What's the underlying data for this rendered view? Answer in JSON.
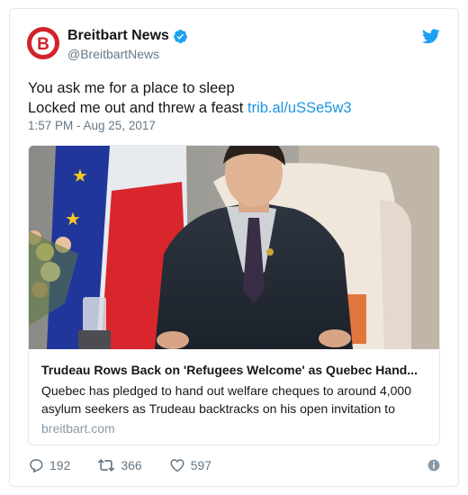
{
  "account": {
    "display_name": "Breitbart News",
    "handle": "@BreitbartNews",
    "avatar_letter": "B",
    "brand_color": "#d3232a",
    "verified": true
  },
  "tweet": {
    "line1": "You ask me for a place to sleep",
    "line2_text": "Locked me out and threw a feast ",
    "link_text": "trib.al/uSSe5w3",
    "timestamp": "1:57 PM - Aug 25, 2017"
  },
  "card": {
    "title": "Trudeau Rows Back on 'Refugees Welcome' as Quebec Hand...",
    "description": "Quebec has pledged to hand out welfare cheques to around 4,000 asylum seekers as Trudeau backtracks on his open invitation to",
    "domain": "breitbart.com"
  },
  "actions": {
    "replies": "192",
    "retweets": "366",
    "likes": "597"
  },
  "colors": {
    "link": "#1b95e0",
    "muted": "#657786",
    "twitter_blue": "#1da1f2"
  },
  "icons": [
    "twitter-bird-icon",
    "verified-badge-icon",
    "reply-icon",
    "retweet-icon",
    "like-icon",
    "info-icon"
  ]
}
